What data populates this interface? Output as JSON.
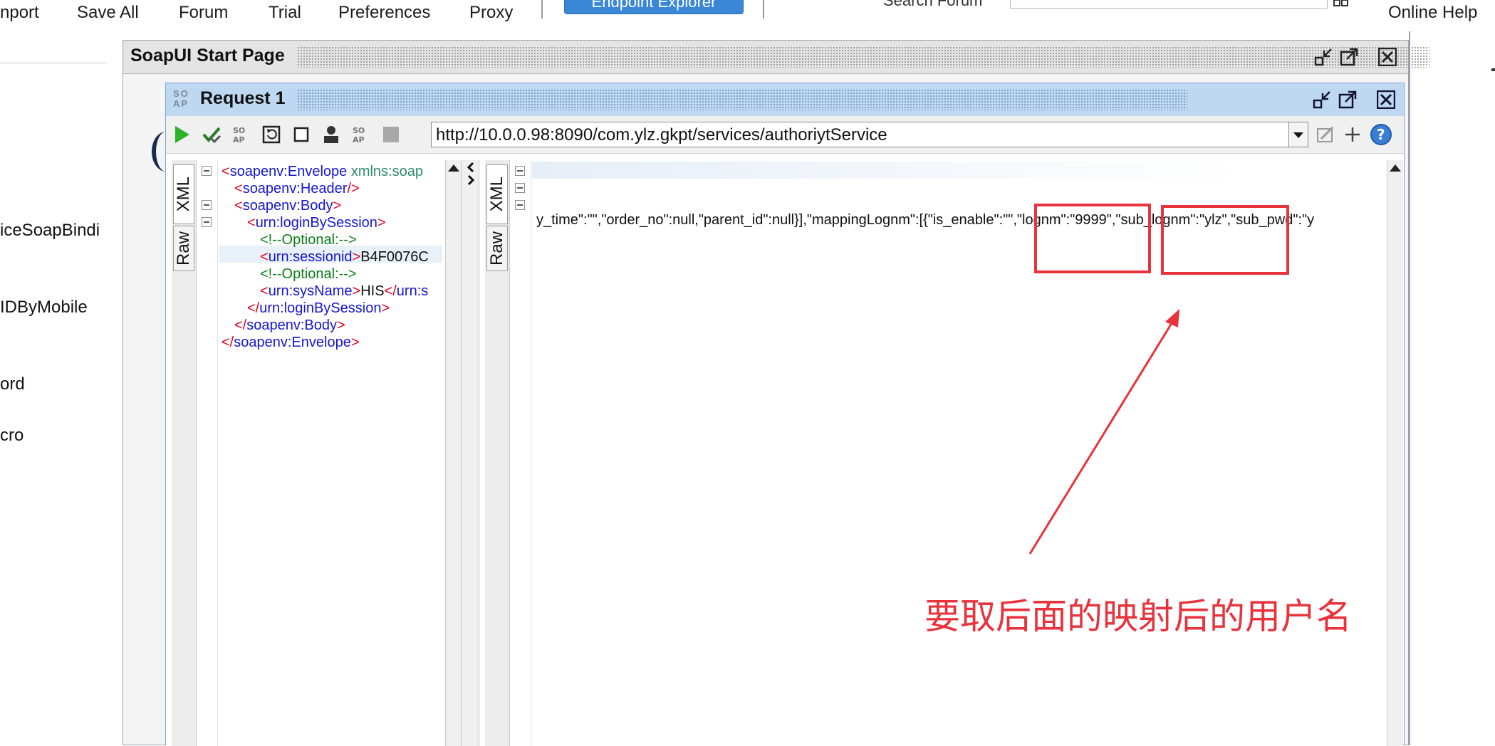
{
  "toolbar": {
    "items": [
      "nport",
      "Save All",
      "Forum",
      "Trial",
      "Preferences",
      "Proxy"
    ],
    "endpoint_explorer": "Endpoint Explorer",
    "search_label": "Search Forum",
    "online_help": "Online Help"
  },
  "navigator": {
    "items": [
      "iceSoapBindi",
      "IDByMobile",
      "ord",
      "cro"
    ]
  },
  "start_page": {
    "title": "SoapUI Start Page"
  },
  "request": {
    "title": "Request 1",
    "endpoint": "http://10.0.0.98:8090/com.ylz.gkpt/services/authoriytService",
    "tabs": {
      "xml": "XML",
      "raw": "Raw"
    },
    "xml_lines": [
      {
        "b1": "<",
        "tag": "soapenv:Envelope",
        "attr": " xmlns:soap"
      },
      {
        "b1": "<",
        "tag": "soapenv:Header",
        "b2": "/>"
      },
      {
        "b1": "<",
        "tag": "soapenv:Body",
        "b2": ">"
      },
      {
        "b1": "<",
        "tag": "urn:loginBySession",
        "b2": ">"
      },
      {
        "comment": "<!--Optional:-->"
      },
      {
        "b1": "<",
        "tag": "urn:sessionid",
        "b2": ">",
        "text": "B4F0076C"
      },
      {
        "comment": "<!--Optional:-->"
      },
      {
        "b1": "<",
        "tag": "urn:sysName",
        "b2": ">",
        "text": "HIS",
        "b3": "</",
        "tag2": "urn:s"
      },
      {
        "b1": "</",
        "tag": "urn:loginBySession",
        "b2": ">"
      },
      {
        "b1": "</",
        "tag": "soapenv:Body",
        "b2": ">"
      },
      {
        "b1": "</",
        "tag": "soapenv:Envelope",
        "b2": ">"
      }
    ]
  },
  "response": {
    "tabs": {
      "xml": "XML",
      "raw": "Raw"
    },
    "line": "y_time\":\"\",\"order_no\":null,\"parent_id\":null}],\"mappingLognm\":[{\"is_enable\":\"\",\"lognm\":\"9999\",\"sub_lognm\":\"ylz\",\"sub_pwd\":\"y"
  },
  "annotation": {
    "text": "要取后面的映射后的用户名",
    "color": "#e8323c"
  },
  "colors": {
    "tag": "#1515d6",
    "bracket": "#e3001b",
    "attribute": "#2b8a6b",
    "comment": "#0a7d19",
    "title_blue": "#bfd8f2"
  }
}
